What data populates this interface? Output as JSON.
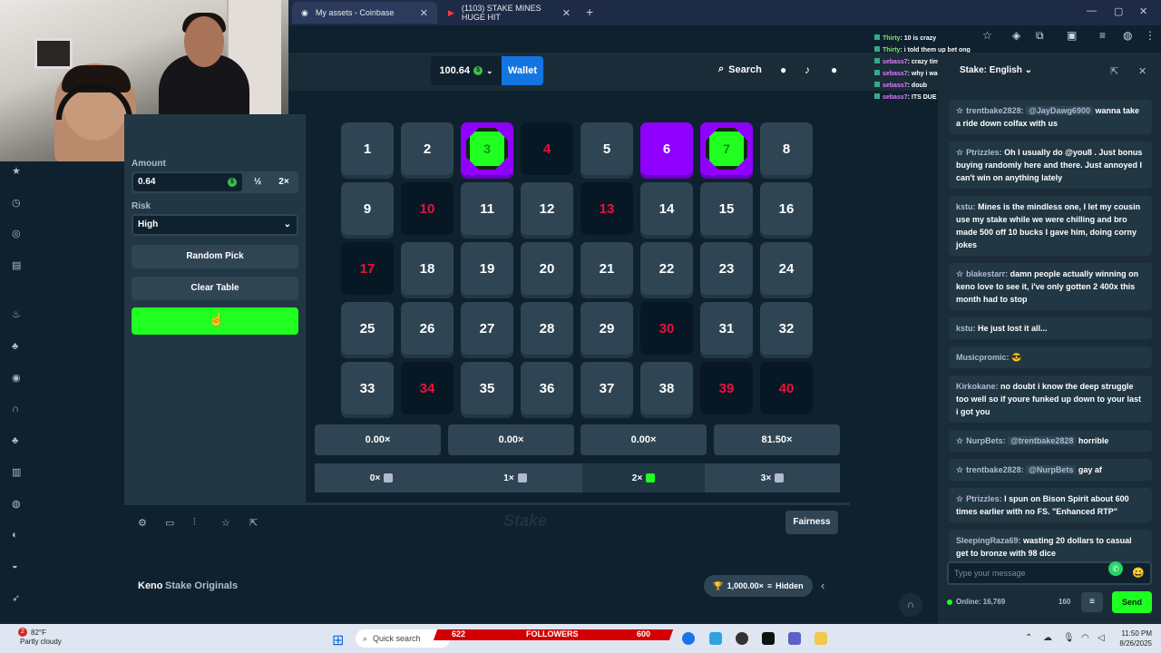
{
  "browser": {
    "tabs": [
      {
        "label": "My assets - Coinbase"
      },
      {
        "label": "(1103) STAKE MINES HUGE HIT"
      }
    ],
    "new_tab": "+",
    "window_controls": [
      "—",
      "▢",
      "✕"
    ]
  },
  "stream_overlay": {
    "chat_lines": [
      {
        "user": "Thirty",
        "text": ": 10 is crazy",
        "color": "#7fe36b"
      },
      {
        "user": "Thirty",
        "text": ": i told them up bet ong",
        "color": "#7fe36b"
      },
      {
        "user": "sebass7",
        "text": ": crazy time calling",
        "color": "#e07cff"
      },
      {
        "user": "sebass7",
        "text": ": why i want to be a chatter mod",
        "color": "#e07cff"
      },
      {
        "user": "sebass7",
        "text": ": doub",
        "color": "#e07cff"
      },
      {
        "user": "sebass7",
        "text": ": ITS DUE",
        "color": "#e07cff"
      }
    ]
  },
  "header": {
    "balance": "100.64",
    "wallet_label": "Wallet",
    "search_label": "Search",
    "chat_title": "Stake: English"
  },
  "controls": {
    "amount_label": "Amount",
    "amount_value": "0.64",
    "half_label": "½",
    "double_label": "2×",
    "risk_label": "Risk",
    "risk_value": "High",
    "random_pick_label": "Random Pick",
    "clear_table_label": "Clear Table",
    "bet_label": ""
  },
  "board": {
    "tiles": [
      {
        "n": "1",
        "state": "normal"
      },
      {
        "n": "2",
        "state": "normal"
      },
      {
        "n": "3",
        "state": "hit"
      },
      {
        "n": "4",
        "state": "miss"
      },
      {
        "n": "5",
        "state": "normal"
      },
      {
        "n": "6",
        "state": "sel"
      },
      {
        "n": "7",
        "state": "hit"
      },
      {
        "n": "8",
        "state": "normal"
      },
      {
        "n": "9",
        "state": "normal"
      },
      {
        "n": "10",
        "state": "miss"
      },
      {
        "n": "11",
        "state": "normal"
      },
      {
        "n": "12",
        "state": "normal"
      },
      {
        "n": "13",
        "state": "miss"
      },
      {
        "n": "14",
        "state": "normal"
      },
      {
        "n": "15",
        "state": "normal"
      },
      {
        "n": "16",
        "state": "normal"
      },
      {
        "n": "17",
        "state": "miss"
      },
      {
        "n": "18",
        "state": "normal"
      },
      {
        "n": "19",
        "state": "normal"
      },
      {
        "n": "20",
        "state": "normal"
      },
      {
        "n": "21",
        "state": "normal"
      },
      {
        "n": "22",
        "state": "normal"
      },
      {
        "n": "23",
        "state": "normal"
      },
      {
        "n": "24",
        "state": "normal"
      },
      {
        "n": "25",
        "state": "normal"
      },
      {
        "n": "26",
        "state": "normal"
      },
      {
        "n": "27",
        "state": "normal"
      },
      {
        "n": "28",
        "state": "normal"
      },
      {
        "n": "29",
        "state": "normal"
      },
      {
        "n": "30",
        "state": "miss"
      },
      {
        "n": "31",
        "state": "normal"
      },
      {
        "n": "32",
        "state": "normal"
      },
      {
        "n": "33",
        "state": "normal"
      },
      {
        "n": "34",
        "state": "miss"
      },
      {
        "n": "35",
        "state": "normal"
      },
      {
        "n": "36",
        "state": "normal"
      },
      {
        "n": "37",
        "state": "normal"
      },
      {
        "n": "38",
        "state": "normal"
      },
      {
        "n": "39",
        "state": "miss"
      },
      {
        "n": "40",
        "state": "miss"
      }
    ],
    "payouts": [
      "0.00×",
      "0.00×",
      "0.00×",
      "81.50×"
    ],
    "hit_counts": [
      {
        "label": "0×",
        "active": false
      },
      {
        "label": "1×",
        "active": false
      },
      {
        "label": "2×",
        "active": true
      },
      {
        "label": "3×",
        "active": false
      }
    ]
  },
  "footer": {
    "watermark": "Stake",
    "fairness_label": "Fairness",
    "game_title": "Keno",
    "game_sub": "Stake Originals",
    "max_win": "1,000.00×",
    "hidden_label": "Hidden"
  },
  "chat": {
    "messages": [
      {
        "star": true,
        "user": "trentbake2828:",
        "mention": "@JayDawg6900",
        "text": " wanna take a ride down colfax with us"
      },
      {
        "star": true,
        "user": "Ptrizzles:",
        "mention": "",
        "text": " Oh I usually do @you8 . Just bonus buying randomly here and there. Just annoyed I can't win on anything lately"
      },
      {
        "star": false,
        "user": "kstu:",
        "mention": "",
        "text": " Mines is the mindless one, I let my cousin use my stake while we were chilling and bro made 500 off 10 bucks I gave him, doing corny jokes"
      },
      {
        "star": true,
        "user": "blakestarr:",
        "mention": "",
        "text": " damn people actually winning on keno love to see it, i've only gotten 2 400x this month had to stop"
      },
      {
        "star": false,
        "user": "kstu:",
        "mention": "",
        "text": " He just lost it all..."
      },
      {
        "star": false,
        "user": "Musicpromic:",
        "mention": "",
        "text": " 😎"
      },
      {
        "star": false,
        "user": "Kirkokane:",
        "mention": "",
        "text": " no doubt i know the deep struggle too well so if youre funked up down to your last i got you"
      },
      {
        "star": true,
        "user": "NurpBets:",
        "mention": "@trentbake2828",
        "text": " horrible"
      },
      {
        "star": true,
        "user": "trentbake2828:",
        "mention": "@NurpBets",
        "text": " gay af"
      },
      {
        "star": true,
        "user": "Ptrizzles:",
        "mention": "",
        "text": " I spun on Bison Spirit about 600 times earlier with no FS. \"Enhanced RTP\""
      },
      {
        "star": false,
        "user": "SleepingRaza69:",
        "mention": "",
        "text": " wasting 20 dollars to casual get to bronze with 98 dice"
      }
    ],
    "input_placeholder": "Type your message",
    "online_label": "Online: 16,769",
    "char_count": "160",
    "send_label": "Send"
  },
  "taskbar": {
    "temp": "82°F",
    "weather": "Partly cloudy",
    "weather_badge": "2",
    "search_label": "Quick search",
    "followers_left": "622",
    "followers_label": "FOLLOWERS",
    "followers_right": "600",
    "time": "11:50 PM",
    "date": "8/26/2025"
  }
}
